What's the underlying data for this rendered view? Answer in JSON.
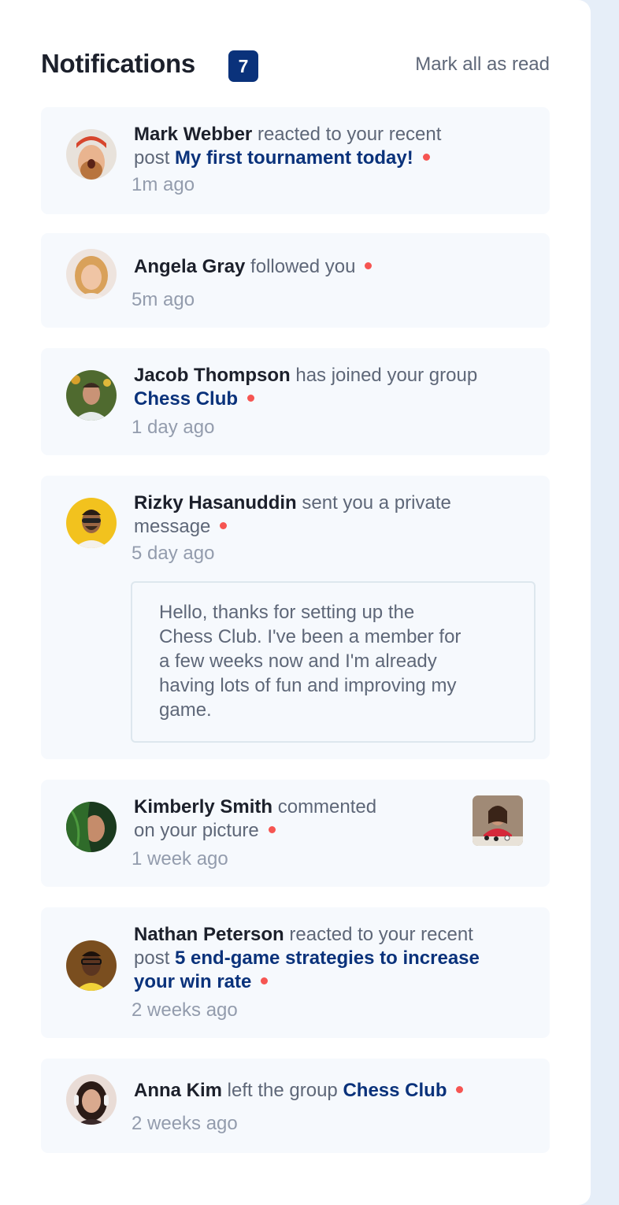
{
  "header": {
    "title": "Notifications",
    "count": "7",
    "mark_all_label": "Mark all as read"
  },
  "colors": {
    "accent": "#0a327b",
    "unread_dot": "#f65552",
    "card_bg": "#f6f9fd",
    "page_bg": "#e6eef8"
  },
  "notifications": [
    {
      "name": "Mark Webber",
      "action_1": " reacted to your recent",
      "action_2": "post ",
      "target": "My first tournament today!",
      "time": "1m ago",
      "unread": true
    },
    {
      "name": "Angela Gray",
      "action_1": " followed you",
      "time": "5m ago",
      "unread": true
    },
    {
      "name": "Jacob Thompson",
      "action_1": " has joined your group",
      "target": "Chess Club",
      "time": "1 day ago",
      "unread": true
    },
    {
      "name": "Rizky Hasanuddin",
      "action_1": " sent you a private",
      "action_2": "message",
      "time": "5 day ago",
      "unread": true,
      "message_lines": [
        "Hello, thanks for setting up the",
        "Chess Club. I've been a member for",
        "a few weeks now and I'm already",
        "having lots of fun and improving my",
        "game."
      ]
    },
    {
      "name": "Kimberly Smith",
      "action_1": " commented",
      "action_2": "on your picture",
      "time": "1 week ago",
      "unread": true,
      "thumbnail_icon": "chess-picture-thumbnail"
    },
    {
      "name": "Nathan Peterson",
      "action_1": " reacted to your recent",
      "action_2": "post ",
      "target_1": "5 end-game strategies to increase",
      "target_2": "your win rate",
      "time": "2 weeks ago",
      "unread": true
    },
    {
      "name": "Anna Kim",
      "action_1": " left the group ",
      "target": "Chess Club",
      "time": "2 weeks ago",
      "unread": true
    }
  ]
}
